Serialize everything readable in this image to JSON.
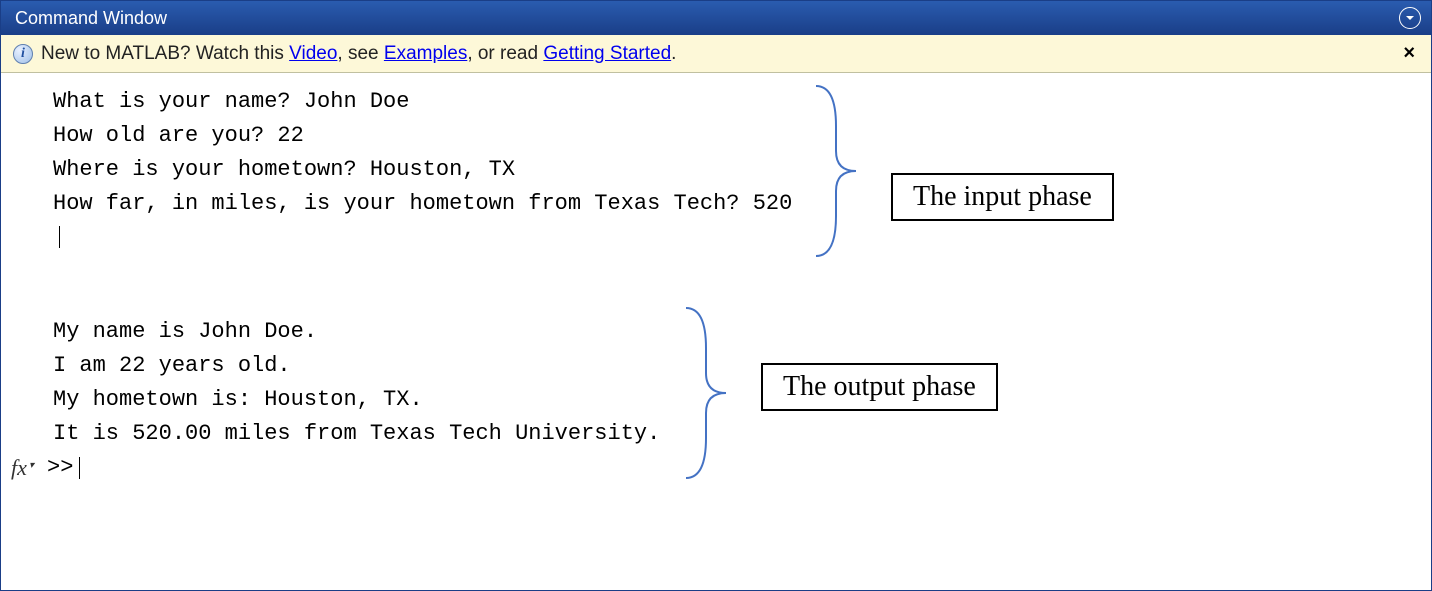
{
  "titlebar": {
    "title": "Command Window"
  },
  "infobar": {
    "prefix": "New to MATLAB? Watch this ",
    "link1": "Video",
    "mid1": ", see ",
    "link2": "Examples",
    "mid2": ", or read ",
    "link3": "Getting Started",
    "suffix": "."
  },
  "console": {
    "input_lines": [
      "What is your name? John Doe",
      "How old are you? 22",
      "Where is your hometown? Houston, TX",
      "How far, in miles, is your hometown from Texas Tech? 520"
    ],
    "output_lines": [
      "My name is John Doe.",
      "I am 22 years old.",
      "My hometown is: Houston, TX.",
      "It is 520.00 miles from Texas Tech University."
    ],
    "prompt": ">>",
    "fx_label": "fx"
  },
  "annotations": {
    "input_label": "The input phase",
    "output_label": "The output phase"
  },
  "colors": {
    "titlebar_bg": "#1a3e87",
    "infobar_bg": "#fdf8d8",
    "link": "#0000ee",
    "bracket": "#4472c4"
  }
}
